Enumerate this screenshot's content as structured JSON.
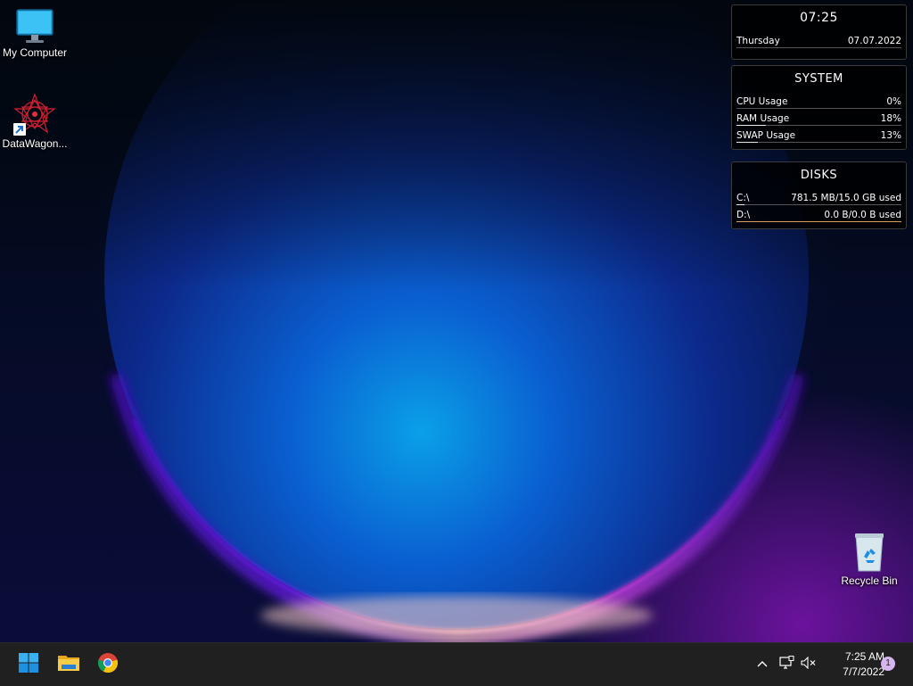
{
  "desktop": {
    "icons": [
      {
        "label": "My Computer"
      },
      {
        "label": "DataWagon..."
      },
      {
        "label": "Recycle Bin"
      }
    ]
  },
  "widgets": {
    "clock": {
      "time": "07:25",
      "day": "Thursday",
      "date": "07.07.2022"
    },
    "system": {
      "title": "SYSTEM",
      "rows": [
        {
          "label": "CPU Usage",
          "value": "0%",
          "fraction": 0.0
        },
        {
          "label": "RAM Usage",
          "value": "18%",
          "fraction": 0.18
        },
        {
          "label": "SWAP Usage",
          "value": "13%",
          "fraction": 0.13
        }
      ]
    },
    "disks": {
      "title": "DISKS",
      "rows": [
        {
          "label": "C:\\",
          "value": "781.5 MB/15.0 GB used",
          "fraction": 0.05
        },
        {
          "label": "D:\\",
          "value": "0.0 B/0.0 B used",
          "fraction": 0.0
        }
      ]
    }
  },
  "taskbar": {
    "apps": [
      {
        "icon": "windows-start-icon"
      },
      {
        "icon": "file-explorer-icon"
      },
      {
        "icon": "chrome-icon"
      }
    ],
    "tray": {
      "icons": [
        "chevron-up-icon",
        "network-icon",
        "volume-muted-icon"
      ],
      "time": "7:25 AM",
      "date": "7/7/2022",
      "notification_count": "1"
    }
  },
  "colors": {
    "taskbar": "#202020",
    "widget_bg": "#000000",
    "disk_line": "#d4a060",
    "badge": "#d7b6f0"
  }
}
